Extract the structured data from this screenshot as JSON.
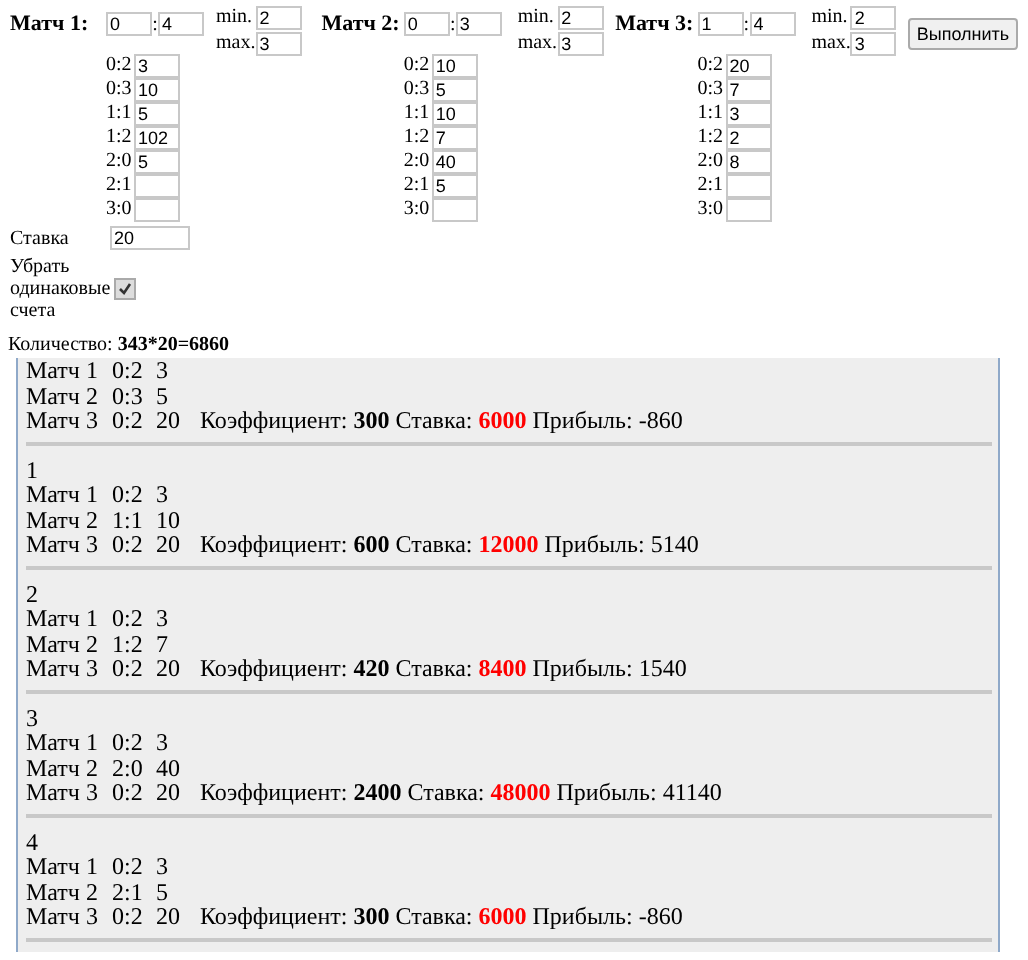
{
  "matches": [
    {
      "label": "Матч 1:",
      "score_home": "0",
      "score_away": "4",
      "separator": ":",
      "min_label": "min.",
      "min": "2",
      "max_label": "max.",
      "max": "3",
      "scores": [
        {
          "score": "0:2",
          "value": "3"
        },
        {
          "score": "0:3",
          "value": "10"
        },
        {
          "score": "1:1",
          "value": "5"
        },
        {
          "score": "1:2",
          "value": "102"
        },
        {
          "score": "2:0",
          "value": "5"
        },
        {
          "score": "2:1"
        },
        {
          "score": "3:0"
        }
      ]
    },
    {
      "label": "Матч 2:",
      "score_home": "0",
      "score_away": "3",
      "separator": ":",
      "min_label": "min.",
      "min": "2",
      "max_label": "max.",
      "max": "3",
      "scores": [
        {
          "score": "0:2",
          "value": "10"
        },
        {
          "score": "0:3",
          "value": "5"
        },
        {
          "score": "1:1",
          "value": "10"
        },
        {
          "score": "1:2",
          "value": "7"
        },
        {
          "score": "2:0",
          "value": "40"
        },
        {
          "score": "2:1",
          "value": "5"
        },
        {
          "score": "3:0"
        }
      ]
    },
    {
      "label": "Матч 3:",
      "score_home": "1",
      "score_away": "4",
      "separator": ":",
      "min_label": "min.",
      "min": "2",
      "max_label": "max.",
      "max": "3",
      "scores": [
        {
          "score": "0:2",
          "value": "20"
        },
        {
          "score": "0:3",
          "value": "7"
        },
        {
          "score": "1:1",
          "value": "3"
        },
        {
          "score": "1:2",
          "value": "2"
        },
        {
          "score": "2:0",
          "value": "8"
        },
        {
          "score": "2:1"
        },
        {
          "score": "3:0"
        }
      ]
    }
  ],
  "run_button": "Выполнить",
  "stake": {
    "label": "Ставка",
    "value": "20"
  },
  "remove_duplicates": {
    "label": "Убрать одинаковые счета",
    "checked": true
  },
  "count": {
    "label": "Количество:",
    "value": "343*20=6860"
  },
  "results": [
    {
      "rows": [
        {
          "match": "Матч 1",
          "score": "0:2",
          "coef": "3"
        },
        {
          "match": "Матч 2",
          "score": "0:3",
          "coef": "5"
        },
        {
          "match": "Матч 3",
          "score": "0:2",
          "coef": "20"
        }
      ],
      "coef_label": "Коэффициент:",
      "coef": "300",
      "stake_label": "Ставка:",
      "stake": "6000",
      "profit_label": "Прибыль:",
      "profit": "-860"
    },
    {
      "index": "1",
      "rows": [
        {
          "match": "Матч 1",
          "score": "0:2",
          "coef": "3"
        },
        {
          "match": "Матч 2",
          "score": "1:1",
          "coef": "10"
        },
        {
          "match": "Матч 3",
          "score": "0:2",
          "coef": "20"
        }
      ],
      "coef_label": "Коэффициент:",
      "coef": "600",
      "stake_label": "Ставка:",
      "stake": "12000",
      "profit_label": "Прибыль:",
      "profit": "5140"
    },
    {
      "index": "2",
      "rows": [
        {
          "match": "Матч 1",
          "score": "0:2",
          "coef": "3"
        },
        {
          "match": "Матч 2",
          "score": "1:2",
          "coef": "7"
        },
        {
          "match": "Матч 3",
          "score": "0:2",
          "coef": "20"
        }
      ],
      "coef_label": "Коэффициент:",
      "coef": "420",
      "stake_label": "Ставка:",
      "stake": "8400",
      "profit_label": "Прибыль:",
      "profit": "1540"
    },
    {
      "index": "3",
      "rows": [
        {
          "match": "Матч 1",
          "score": "0:2",
          "coef": "3"
        },
        {
          "match": "Матч 2",
          "score": "2:0",
          "coef": "40"
        },
        {
          "match": "Матч 3",
          "score": "0:2",
          "coef": "20"
        }
      ],
      "coef_label": "Коэффициент:",
      "coef": "2400",
      "stake_label": "Ставка:",
      "stake": "48000",
      "profit_label": "Прибыль:",
      "profit": "41140"
    },
    {
      "index": "4",
      "rows": [
        {
          "match": "Матч 1",
          "score": "0:2",
          "coef": "3"
        },
        {
          "match": "Матч 2",
          "score": "2:1",
          "coef": "5"
        },
        {
          "match": "Матч 3",
          "score": "0:2",
          "coef": "20"
        }
      ],
      "coef_label": "Коэффициент:",
      "coef": "300",
      "stake_label": "Ставка:",
      "stake": "6000",
      "profit_label": "Прибыль:",
      "profit": "-860"
    }
  ]
}
